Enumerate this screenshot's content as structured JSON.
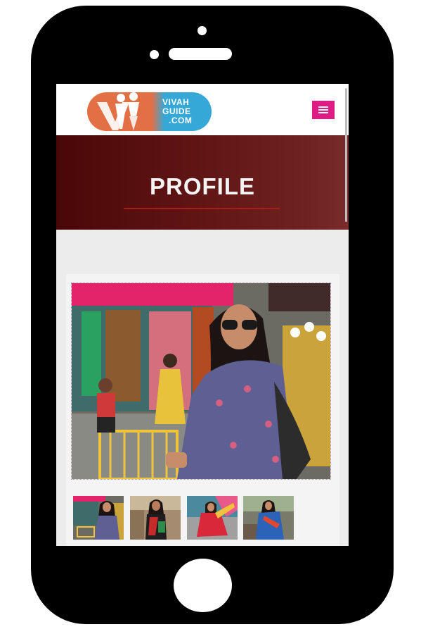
{
  "logo": {
    "line1": "VIVAH",
    "line2": "GUIDE",
    "line3": ".COM"
  },
  "menu": {
    "icon": "hamburger-menu-icon"
  },
  "banner": {
    "title": "PROFILE"
  },
  "colors": {
    "phone_body": "#000000",
    "menu_button": "#e01b84",
    "banner_dark": "#4a0707",
    "banner_underline": "#a71c1c",
    "logo_orange": "#e36f45",
    "logo_blue": "#36a8d8"
  },
  "gallery": {
    "main_image": "profile-photo",
    "thumbnails": [
      "profile-thumb-1",
      "profile-thumb-2",
      "profile-thumb-3",
      "profile-thumb-4"
    ]
  }
}
